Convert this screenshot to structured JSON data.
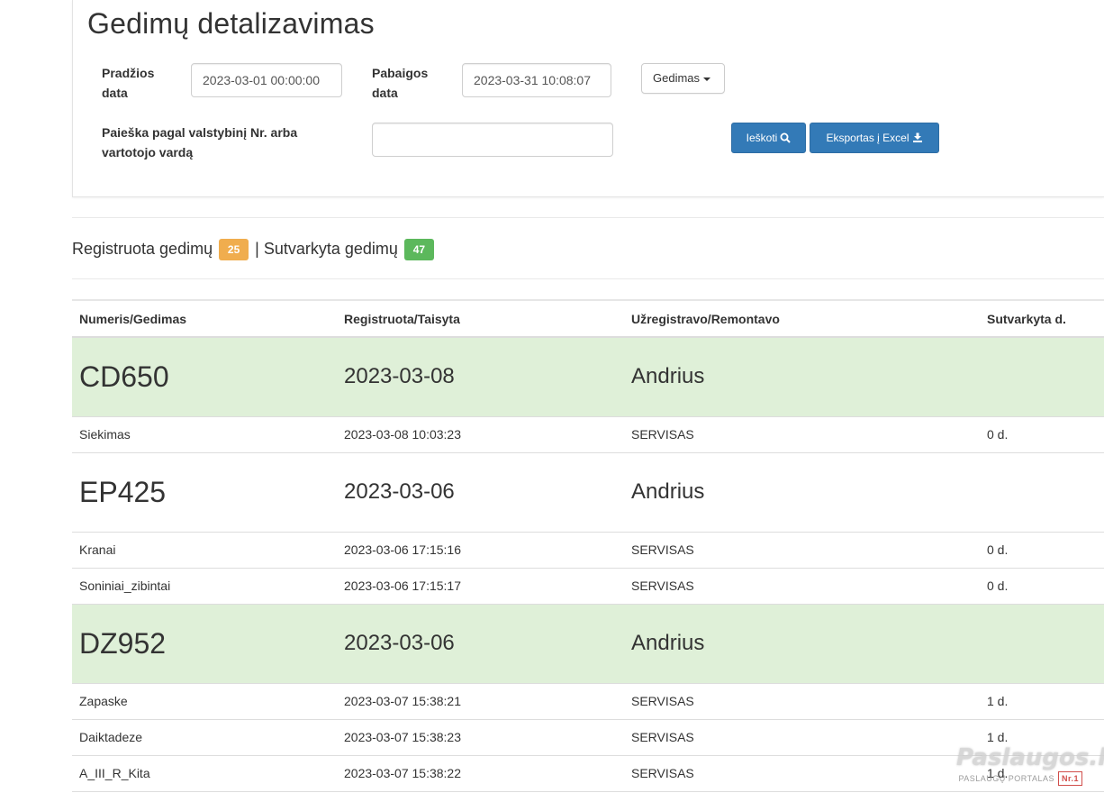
{
  "page": {
    "title": "Gedimų detalizavimas"
  },
  "filters": {
    "start_label": "Pradžios data",
    "start_value": "2023-03-01 00:00:00",
    "end_label": "Pabaigos data",
    "end_value": "2023-03-31 10:08:07",
    "type_dropdown": "Gedimas",
    "search_label": "Paieška pagal valstybinį Nr. arba vartotojo vardą",
    "search_value": "",
    "search_button": "Ieškoti",
    "export_button": "Eksportas į Excel"
  },
  "summary": {
    "registered_label": "Registruota gedimų",
    "registered_count": "25",
    "separator": "|",
    "fixed_label": "Sutvarkyta gedimų",
    "fixed_count": "47"
  },
  "table": {
    "headers": [
      "Numeris/Gedimas",
      "Registruota/Taisyta",
      "Užregistravo/Remontavo",
      "Sutvarkyta d."
    ],
    "groups": [
      {
        "plate": "CD650",
        "date": "2023-03-08",
        "user": "Andrius",
        "highlighted": true,
        "rows": [
          [
            "Siekimas",
            "2023-03-08 10:03:23",
            "SERVISAS",
            "0 d."
          ]
        ]
      },
      {
        "plate": "EP425",
        "date": "2023-03-06",
        "user": "Andrius",
        "highlighted": false,
        "rows": [
          [
            "Kranai",
            "2023-03-06 17:15:16",
            "SERVISAS",
            "0 d."
          ],
          [
            "Soniniai_zibintai",
            "2023-03-06 17:15:17",
            "SERVISAS",
            "0 d."
          ]
        ]
      },
      {
        "plate": "DZ952",
        "date": "2023-03-06",
        "user": "Andrius",
        "highlighted": true,
        "rows": [
          [
            "Zapaske",
            "2023-03-07 15:38:21",
            "SERVISAS",
            "1 d."
          ],
          [
            "Daiktadeze",
            "2023-03-07 15:38:23",
            "SERVISAS",
            "1 d."
          ],
          [
            "A_III_R_Kita",
            "2023-03-07 15:38:22",
            "SERVISAS",
            "1 d."
          ]
        ]
      }
    ]
  },
  "watermark": {
    "brand": "Paslaugos.lt",
    "tagline": "PASLAUGŲ PORTALAS",
    "rank": "Nr.1"
  },
  "colors": {
    "primary": "#337ab7",
    "badge_orange": "#f0ad4e",
    "badge_green": "#5cb85c",
    "row_highlight": "#dff0d8"
  }
}
